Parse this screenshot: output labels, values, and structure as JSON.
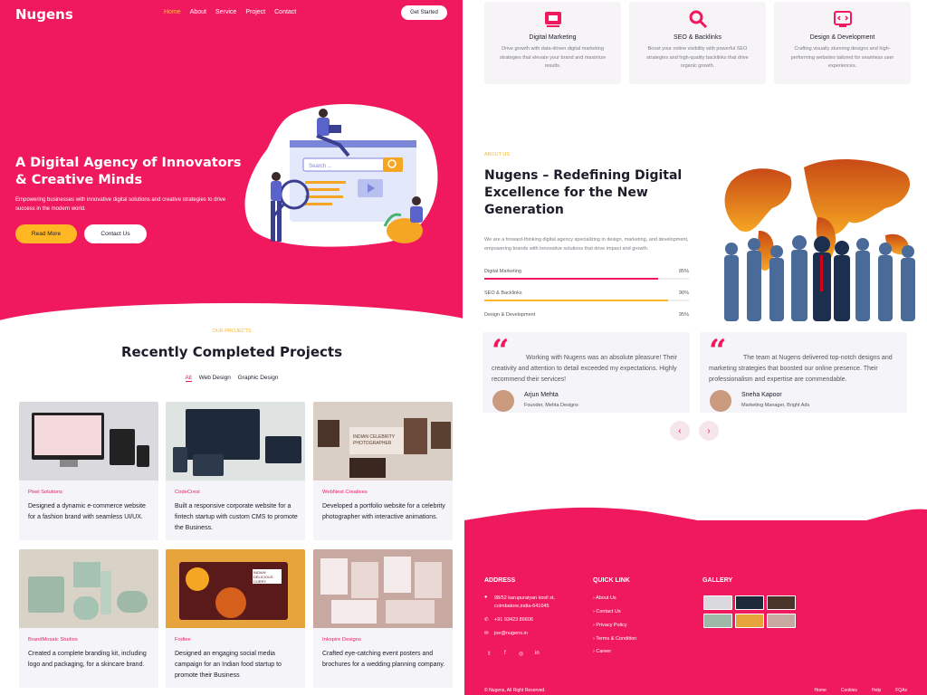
{
  "hero": {
    "logo": "Nugens",
    "nav": [
      "Home",
      "About",
      "Service",
      "Project",
      "Contact"
    ],
    "cta_top": "Get Started",
    "headline": "A Digital Agency of Innovators & Creative Minds",
    "subtext": "Empowering businesses with innovative digital solutions and creative strategies to drive success in the modern world.",
    "btn_primary": "Read More",
    "btn_secondary": "Contact Us",
    "search_placeholder": "Search ..."
  },
  "services": [
    {
      "title": "Digital Marketing",
      "desc": "Drive growth with data-driven digital marketing strategies that elevate your brand and maximize results.",
      "icon": "megaphone-icon"
    },
    {
      "title": "SEO & Backlinks",
      "desc": "Boost your online visibility with powerful SEO strategies and high-quality backlinks that drive organic growth.",
      "icon": "search-icon"
    },
    {
      "title": "Design & Development",
      "desc": "Crafting visually stunning designs and high-performing websites tailored for seamless user experiences.",
      "icon": "code-icon"
    }
  ],
  "about": {
    "tag": "ABOUT US",
    "title": "Nugens – Redefining Digital Excellence for the New Generation",
    "desc": "We are a forward-thinking digital agency specializing in design, marketing, and development, empowering brands with innovative solutions that drive impact and growth.",
    "skills": [
      {
        "name": "Digital Marketing",
        "value": "85%",
        "fraction": 0.85,
        "color": "#f0195d"
      },
      {
        "name": "SEO & Backlinks",
        "value": "90%",
        "fraction": 0.9,
        "color": "#ffb824"
      },
      {
        "name": "Design & Development",
        "value": "95%",
        "fraction": 0.95,
        "color": "#f0195d"
      }
    ]
  },
  "projects": {
    "tag": "OUR PROJECTS",
    "title": "Recently Completed Projects",
    "filters": [
      "All",
      "Web Design",
      "Graphic Design"
    ],
    "items": [
      {
        "client": "Pixel Solutions",
        "desc": "Designed a dynamic e-commerce website for a fashion brand with seamless UI/UX.",
        "bg": "#d9d9de"
      },
      {
        "client": "CodeCrest",
        "desc": "Built a responsive corporate website for a fintech startup with custom CMS to promote the Business.",
        "bg": "#dfe4e2"
      },
      {
        "client": "WebNest Creatives",
        "desc": "Developed a portfolio website for a celebrity photographer with interactive animations.",
        "bg": "#d9cfc7"
      },
      {
        "client": "BrandMosaic Studios",
        "desc": "Created a complete branding kit, including logo and packaging, for a skincare brand.",
        "bg": "#d8d3c6"
      },
      {
        "client": "Fodiee",
        "desc": "Designed an engaging social media campaign for an Indian food startup to promote their Business",
        "bg": "#e7a43c"
      },
      {
        "client": "Inkspire Designs",
        "desc": "Crafted eye-catching event posters and brochures for a wedding planning company.",
        "bg": "#c8a9a2"
      }
    ],
    "fodiee_banner": "INDIAN DELICIOUS CURRY",
    "celeb_banner": "INDIAN CELEBRITY PHOTOGRAPHER"
  },
  "testimonials": [
    {
      "text": "Working with Nugens was an absolute pleasure! Their creativity and attention to detail exceeded my expectations. Highly recommend their services!",
      "name": "Arjun Mehta",
      "role": "Founder, Mehta Designs"
    },
    {
      "text": "The team at Nugens delivered top-notch designs and marketing strategies that boosted our online presence. Their professionalism and expertise are commendable.",
      "name": "Sneha Kapoor",
      "role": "Marketing Manager, Bright Ads"
    }
  ],
  "footer": {
    "address_h": "ADDRESS",
    "address": "98/52 karupuraiyan kovil st, coimbatore,india-641045",
    "phone": "+91 93423 86606",
    "email": "joe@nugens.in",
    "links_h": "QUICK LINK",
    "links": [
      "About Us",
      "Contact Us",
      "Privacy Policy",
      "Terms & Condition",
      "Career"
    ],
    "gallery_h": "GALLERY",
    "social": [
      "twitter-icon",
      "facebook-icon",
      "instagram-icon",
      "linkedin-icon"
    ],
    "copyright": "© Nugens, All Right Reserved.",
    "bottom_links": [
      "Home",
      "Cookies",
      "Help",
      "FQAs"
    ]
  }
}
